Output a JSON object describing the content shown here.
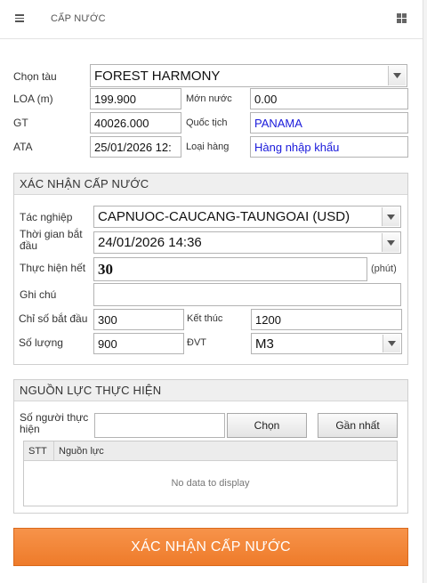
{
  "header": {
    "title": "CẤP NƯỚC",
    "menu_icon": "hamburger-menu-icon",
    "grid_icon": "grid-apps-icon"
  },
  "vessel": {
    "ship_label": "Chọn tàu",
    "ship_value": "FOREST HARMONY",
    "loa_label": "LOA (m)",
    "loa_value": "199.900",
    "draft_label": "Mớn nước",
    "draft_value": "0.00",
    "gt_label": "GT",
    "gt_value": "40026.000",
    "nationality_label": "Quốc tịch",
    "nationality_value": "PANAMA",
    "ata_label": "ATA",
    "ata_value": "25/01/2026 12:",
    "cargo_label": "Loại hàng",
    "cargo_value": "Hàng nhập khẩu"
  },
  "confirm": {
    "title": "XÁC NHẬN CẤP NƯỚC",
    "operation_label": "Tác nghiệp",
    "operation_value": "CAPNUOC-CAUCANG-TAUNGOAI (USD)",
    "start_label": "Thời gian bắt đầu",
    "start_value": "24/01/2026 14:36",
    "duration_label": "Thực hiện hết",
    "duration_value": "30",
    "duration_unit": "(phút)",
    "note_label": "Ghi chú",
    "note_value": "",
    "meter_start_label": "Chỉ số bắt đầu",
    "meter_start_value": "300",
    "meter_end_label": "Kết thúc",
    "meter_end_value": "1200",
    "qty_label": "Số lượng",
    "qty_value": "900",
    "unit_label": "ĐVT",
    "unit_value": "M3"
  },
  "resources": {
    "title": "NGUỒN LỰC THỰC HIỆN",
    "people_label": "Số người thực hiện",
    "people_value": "",
    "choose_button": "Chọn",
    "nearest_button": "Gần nhất",
    "columns": [
      "STT",
      "Nguồn lực"
    ],
    "empty_text": "No data to display"
  },
  "submit_label": "XÁC NHẬN CẤP NƯỚC",
  "colors": {
    "accent": "#f0832f",
    "link_blue": "#1a1adb"
  }
}
